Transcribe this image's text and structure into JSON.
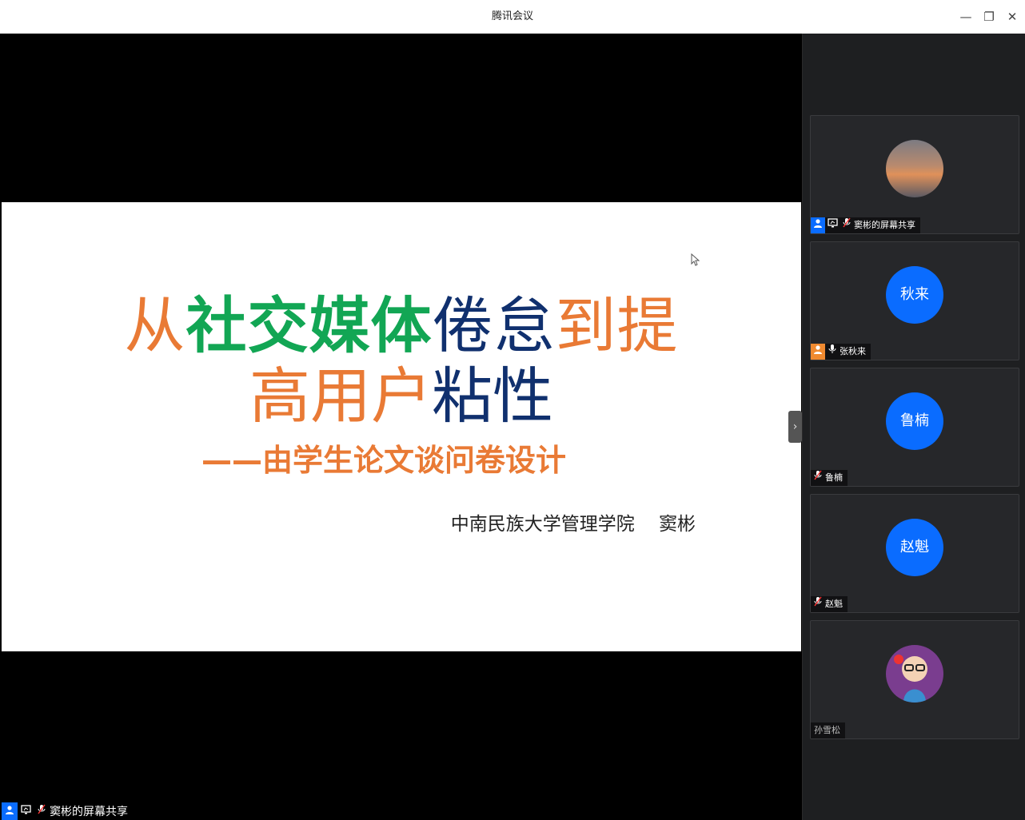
{
  "window": {
    "title": "腾讯会议",
    "controls": {
      "minimize": "—",
      "restore": "❐",
      "close": "✕"
    }
  },
  "slide": {
    "title_line1": [
      {
        "text": "从",
        "color": "#e97a35"
      },
      {
        "text": "社交媒体",
        "color": "#12a654"
      },
      {
        "text": "倦怠",
        "color": "#10306e"
      },
      {
        "text": "到提",
        "color": "#e97a35"
      }
    ],
    "title_line2": [
      {
        "text": "高用户",
        "color": "#e97a35"
      },
      {
        "text": "粘性",
        "color": "#10306e"
      }
    ],
    "subtitle": "——由学生论文谈问卷设计",
    "author": "中南民族大学管理学院　 窦彬"
  },
  "participants": [
    {
      "name": "窦彬的屏幕共享",
      "avatar_text": "",
      "avatar_kind": "photo",
      "role_icon": "host-icon",
      "share_icon": true,
      "mic": "mic-muted-icon"
    },
    {
      "name": "张秋来",
      "avatar_text": "秋来",
      "avatar_kind": "initials",
      "role_icon": "cohost-icon",
      "share_icon": false,
      "mic": "mic-icon"
    },
    {
      "name": "鲁楠",
      "avatar_text": "鲁楠",
      "avatar_kind": "initials",
      "role_icon": "",
      "share_icon": false,
      "mic": "mic-muted-icon"
    },
    {
      "name": "赵魁",
      "avatar_text": "赵魁",
      "avatar_kind": "initials",
      "role_icon": "",
      "share_icon": false,
      "mic": "mic-muted-icon"
    },
    {
      "name": "孙雪松",
      "avatar_text": "",
      "avatar_kind": "cartoon",
      "role_icon": "",
      "share_icon": false,
      "mic": ""
    }
  ],
  "bottom_label": "窦彬的屏幕共享",
  "colors": {
    "accent": "#0a6cff",
    "cohost": "#f08a30",
    "sidebar_bg": "#1e1f21"
  }
}
